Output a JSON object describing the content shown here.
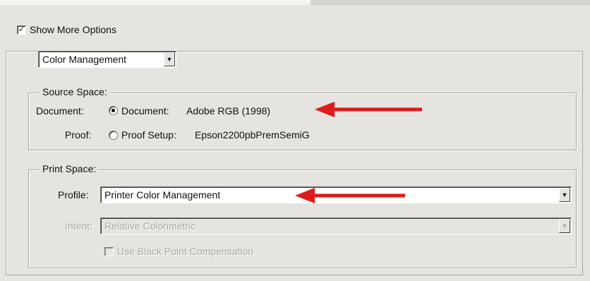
{
  "show_more_options": {
    "label": "Show More Options",
    "checked": true
  },
  "mode_select": {
    "value": "Color Management"
  },
  "source_space": {
    "legend": "Source Space:",
    "document": {
      "label": "Document:",
      "option_label": "Document:",
      "value": "Adobe RGB (1998)",
      "selected": true
    },
    "proof": {
      "label": "Proof:",
      "option_label": "Proof Setup:",
      "value": "Epson2200pbPremSemiG",
      "selected": false
    }
  },
  "print_space": {
    "legend": "Print Space:",
    "profile": {
      "label": "Profile:",
      "value": "Printer Color Management"
    },
    "intent": {
      "label": "Intent:",
      "value": "Relative Colorimetric",
      "disabled": true
    },
    "black_point": {
      "label": "Use Black Point Compensation",
      "checked": false,
      "disabled": true
    }
  },
  "annotation_color": "#e01b1b"
}
